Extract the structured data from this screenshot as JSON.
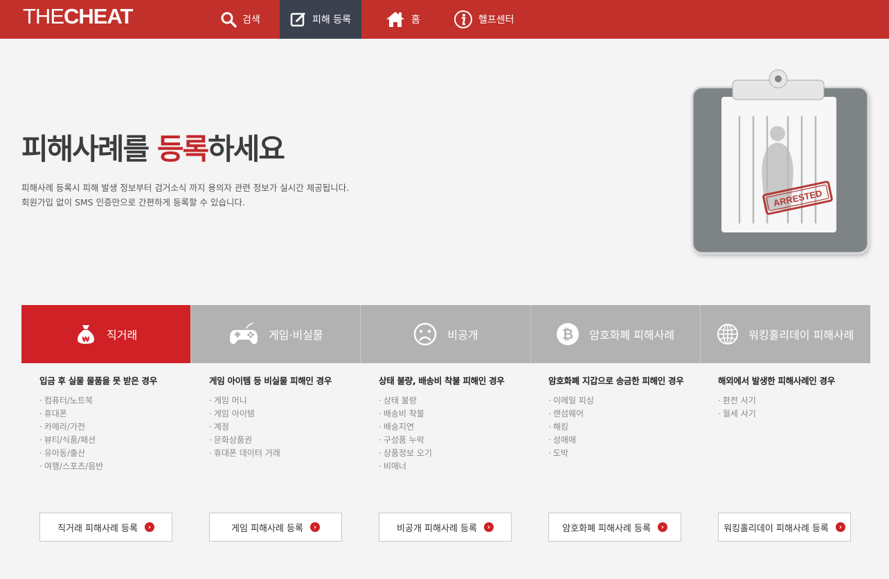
{
  "nav": {
    "logo_thin": "THE",
    "logo_bold": "CHEAT",
    "items": [
      {
        "label": "검색",
        "icon": "search-icon"
      },
      {
        "label": "피해 등록",
        "icon": "edit-icon"
      },
      {
        "label": "홈",
        "icon": "home-icon"
      },
      {
        "label": "헬프센터",
        "icon": "info-icon"
      }
    ]
  },
  "hero": {
    "title_pre": "피해사례를 ",
    "title_red": "등록",
    "title_post": "하세요",
    "desc_line1": "피해사례 등록시 피해 발생 정보부터 검거소식 까지 용의자 관련 정보가 실시간 제공됩니다.",
    "desc_line2": "회원가입 없이 SMS 인증만으로 간편하게 등록할 수 있습니다.",
    "stamp": "ARRESTED"
  },
  "tabs": [
    {
      "label": "직거래",
      "icon": "money-bag-icon"
    },
    {
      "label": "게임·비실물",
      "icon": "gamepad-icon"
    },
    {
      "label": "비공개",
      "icon": "frown-face-icon"
    },
    {
      "label": "암호화폐 피해사례",
      "icon": "bitcoin-icon"
    },
    {
      "label": "워킹홀리데이 피해사례",
      "icon": "globe-icon"
    }
  ],
  "columns": [
    {
      "heading": "입금 후 실물 물품을 못 받은 경우",
      "items": [
        "컴퓨터/노트북",
        "휴대폰",
        "카메라/가전",
        "뷰티/식품/패션",
        "유아동/출산",
        "여행/스포츠/음반"
      ],
      "button": "직거래 피해사례 등록"
    },
    {
      "heading": "게임 아이템 등 비실물 피해인 경우",
      "items": [
        "게임 머니",
        "게임 아이템",
        "계정",
        "문화상품권",
        "휴대폰 데이터 거래"
      ],
      "button": "게임 피해사례 등록"
    },
    {
      "heading": "상태 불량, 배송비 착불 피해인 경우",
      "items": [
        "상태 불량",
        "배송비 착불",
        "배송지연",
        "구성품 누락",
        "상품정보 오기",
        "비매너"
      ],
      "button": "비공개 피해사례 등록"
    },
    {
      "heading": "암호화폐 지갑으로 송금한 피해인 경우",
      "items": [
        "이메일 피싱",
        "랜섬웨어",
        "해킹",
        "성매매",
        "도박"
      ],
      "button": "암호화폐 피해사례 등록"
    },
    {
      "heading": "해외에서 발생한 피해사례인 경우",
      "items": [
        "환전 사기",
        "월세 사기"
      ],
      "button": "워킹홀리데이 피해사례 등록"
    }
  ]
}
